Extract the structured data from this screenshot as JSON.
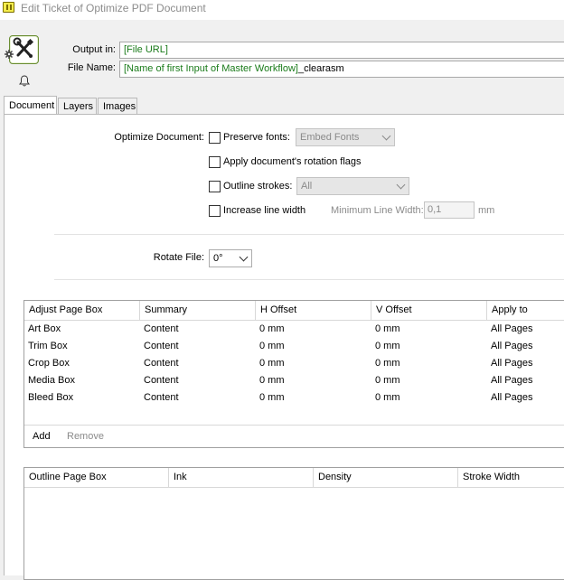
{
  "window": {
    "title": "Edit Ticket of Optimize PDF Document"
  },
  "header": {
    "output_label": "Output in:",
    "output_value": "[File URL]",
    "filename_label": "File Name:",
    "filename_token": "[Name of first Input of Master Workflow]",
    "filename_suffix": "_clearasm"
  },
  "tabs": [
    {
      "label": "Document",
      "active": true
    },
    {
      "label": "Layers",
      "active": false
    },
    {
      "label": "Images",
      "active": false
    }
  ],
  "document": {
    "optimize_label": "Optimize Document:",
    "preserve_fonts": {
      "label": "Preserve fonts:",
      "checked": false,
      "combo_value": "Embed Fonts"
    },
    "rotation_flags": {
      "label": "Apply document's rotation flags",
      "checked": false
    },
    "outline_strokes": {
      "label": "Outline strokes:",
      "checked": false,
      "combo_value": "All"
    },
    "line_width": {
      "label": "Increase line width",
      "checked": false,
      "min_label": "Minimum Line Width:",
      "min_value": "0,1",
      "unit": "mm"
    },
    "rotate_label": "Rotate File:",
    "rotate_value": "0°"
  },
  "page_box_table": {
    "columns": [
      "Adjust Page Box",
      "Summary",
      "H Offset",
      "V Offset",
      "Apply to"
    ],
    "rows": [
      [
        "Art Box",
        "Content",
        "0 mm",
        "0 mm",
        "All Pages"
      ],
      [
        "Trim Box",
        "Content",
        "0 mm",
        "0 mm",
        "All Pages"
      ],
      [
        "Crop Box",
        "Content",
        "0 mm",
        "0 mm",
        "All Pages"
      ],
      [
        "Media Box",
        "Content",
        "0 mm",
        "0 mm",
        "All Pages"
      ],
      [
        "Bleed Box",
        "Content",
        "0 mm",
        "0 mm",
        "All Pages"
      ]
    ],
    "add_label": "Add",
    "remove_label": "Remove"
  },
  "outline_table": {
    "columns": [
      "Outline Page Box",
      "Ink",
      "Density",
      "Stroke Width"
    ]
  },
  "icons": {
    "app": "ticket-icon",
    "tool": "wrench-screwdriver-icon",
    "bell": "bell-icon",
    "gear": "gear-icon"
  },
  "colors": {
    "token_green": "#1a7b1a",
    "icon_border": "#6a8d33"
  }
}
